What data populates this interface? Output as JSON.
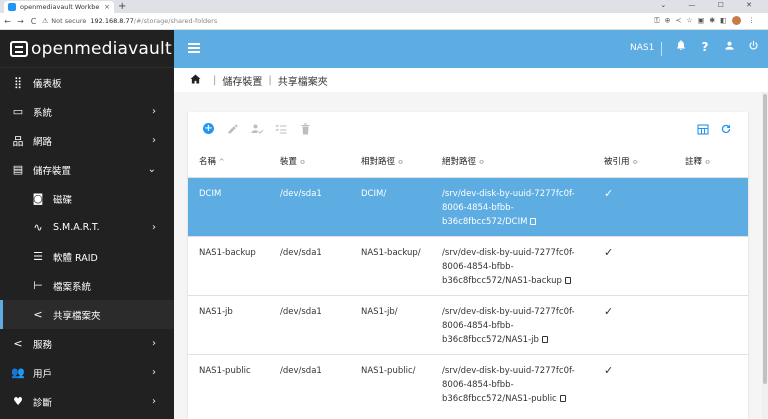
{
  "browser": {
    "tab_title": "openmediavault Workbe",
    "tab_close": "×",
    "new_tab": "+",
    "window_controls": "⌄ — ☐ ✕",
    "nav_back": "←",
    "nav_forward": "→",
    "nav_reload": "C",
    "not_secure": "Not secure",
    "address": "192.168.8.77",
    "path": "/#/storage/shared-folders"
  },
  "sidebar": {
    "logo": "openmediavault",
    "items": [
      {
        "label": "儀表板",
        "icon": "⣿",
        "chevron": ""
      },
      {
        "label": "系統",
        "icon": "▭",
        "chevron": "›"
      },
      {
        "label": "網路",
        "icon": "品",
        "chevron": "›"
      },
      {
        "label": "儲存裝置",
        "icon": "▤",
        "chevron": "⌄"
      },
      {
        "label": "磁碟",
        "icon": "◙",
        "chevron": ""
      },
      {
        "label": "S.M.A.R.T.",
        "icon": "∿",
        "chevron": "›"
      },
      {
        "label": "軟體 RAID",
        "icon": "☰",
        "chevron": ""
      },
      {
        "label": "檔案系統",
        "icon": "⊢",
        "chevron": ""
      },
      {
        "label": "共享檔案夾",
        "icon": "<",
        "chevron": ""
      },
      {
        "label": "服務",
        "icon": "<",
        "chevron": "›"
      },
      {
        "label": "用戶",
        "icon": "👥",
        "chevron": "›"
      },
      {
        "label": "診斷",
        "icon": "♥",
        "chevron": "›"
      }
    ]
  },
  "appbar": {
    "hostname": "NAS1",
    "icons": [
      "bell-icon",
      "help-icon",
      "user-icon",
      "power-icon"
    ]
  },
  "breadcrumb": {
    "home_icon": "home-icon",
    "level1": "儲存裝置",
    "level2": "共享檔案夾"
  },
  "table": {
    "headers": [
      "名稱",
      "裝置",
      "相對路徑",
      "絕對路徑",
      "被引用",
      "註釋"
    ],
    "sort_indicators": [
      "^",
      "≎",
      "≎",
      "≎",
      "≎",
      "≎"
    ],
    "rows": [
      {
        "name": "DCIM",
        "device": "/dev/sda1",
        "relpath": "DCIM/",
        "abspath": "/srv/dev-disk-by-uuid-7277fc0f-8006-4854-bfbb-b36c8fbcc572/DCIM",
        "referenced": "✓",
        "comment": ""
      },
      {
        "name": "NAS1-backup",
        "device": "/dev/sda1",
        "relpath": "NAS1-backup/",
        "abspath": "/srv/dev-disk-by-uuid-7277fc0f-8006-4854-bfbb-b36c8fbcc572/NAS1-backup",
        "referenced": "✓",
        "comment": ""
      },
      {
        "name": "NAS1-jb",
        "device": "/dev/sda1",
        "relpath": "NAS1-jb/",
        "abspath": "/srv/dev-disk-by-uuid-7277fc0f-8006-4854-bfbb-b36c8fbcc572/NAS1-jb",
        "referenced": "✓",
        "comment": ""
      },
      {
        "name": "NAS1-public",
        "device": "/dev/sda1",
        "relpath": "NAS1-public/",
        "abspath": "/srv/dev-disk-by-uuid-7277fc0f-8006-4854-bfbb-b36c8fbcc572/NAS1-public",
        "referenced": "✓",
        "comment": ""
      }
    ]
  },
  "colors": {
    "accent": "#5dade2",
    "sidebar_bg": "#212121",
    "add_button": "#2196f3"
  }
}
